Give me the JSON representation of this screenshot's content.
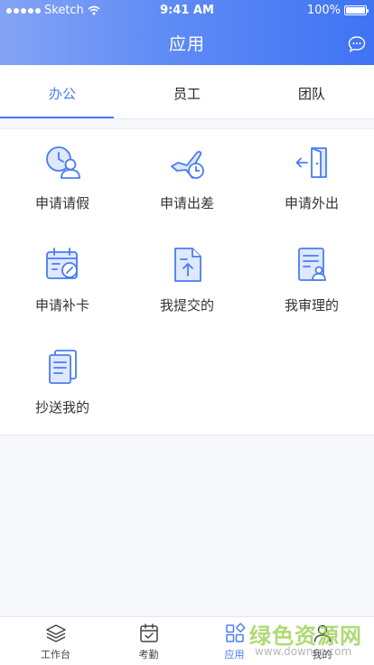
{
  "status_bar": {
    "carrier": "Sketch",
    "time": "9:41 AM",
    "battery": "100%"
  },
  "header": {
    "title": "应用"
  },
  "tabs": [
    {
      "label": "办公"
    },
    {
      "label": "员工"
    },
    {
      "label": "团队"
    }
  ],
  "apps": [
    {
      "label": "申请请假",
      "icon": "leave-request-icon"
    },
    {
      "label": "申请出差",
      "icon": "business-trip-icon"
    },
    {
      "label": "申请外出",
      "icon": "go-out-icon"
    },
    {
      "label": "申请补卡",
      "icon": "makeup-punch-icon"
    },
    {
      "label": "我提交的",
      "icon": "my-submitted-icon"
    },
    {
      "label": "我审理的",
      "icon": "my-approved-icon"
    },
    {
      "label": "抄送我的",
      "icon": "cc-me-icon"
    }
  ],
  "tabbar": [
    {
      "label": "工作台",
      "icon": "layers-icon"
    },
    {
      "label": "考勤",
      "icon": "calendar-check-icon"
    },
    {
      "label": "应用",
      "icon": "apps-grid-icon"
    },
    {
      "label": "我的",
      "icon": "user-icon"
    }
  ],
  "watermark": {
    "title": "绿色资源网",
    "url": "www.downcc.com"
  },
  "colors": {
    "accent": "#4a7cf2",
    "header_start": "#84a3f5",
    "header_end": "#3f73f4",
    "watermark": "#96ce46"
  }
}
